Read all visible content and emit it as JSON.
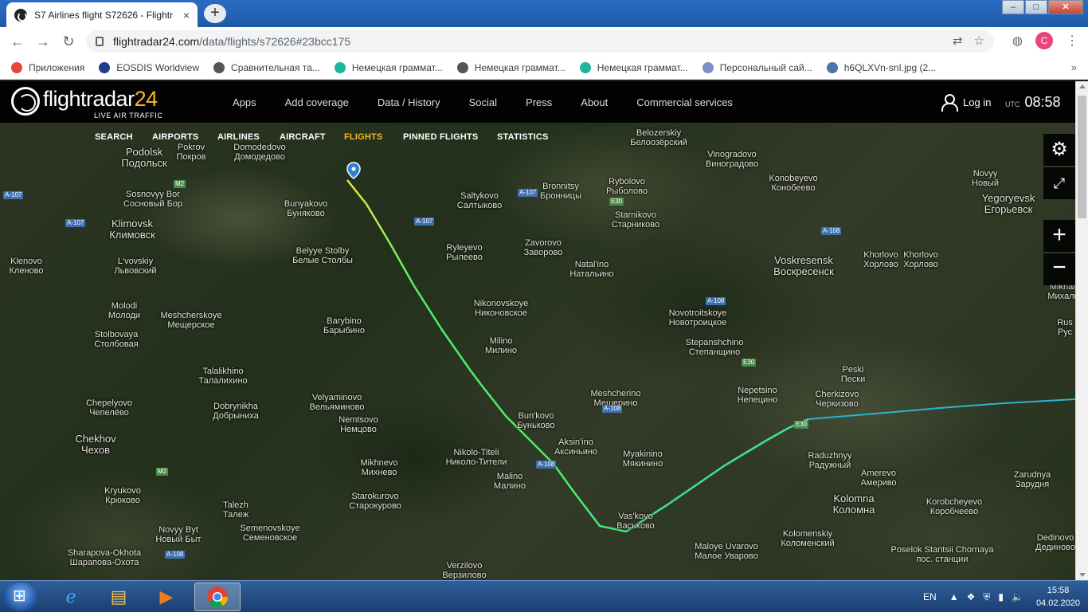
{
  "browser": {
    "tab_title": "S7 Airlines flight S72626 - Flightr",
    "tab_close": "×",
    "new_tab": "+",
    "url_host": "flightradar24.com",
    "url_path": "/data/flights/s72626#23bcc175",
    "window": {
      "minimize": "–",
      "maximize": "□",
      "close": "✕"
    },
    "avatar_letter": "C",
    "bookmarks": [
      {
        "label": "Приложения",
        "color": "#e8453c"
      },
      {
        "label": "EOSDIS Worldview",
        "color": "#1f3d8a"
      },
      {
        "label": "Сравнительная та...",
        "color": "#555555"
      },
      {
        "label": "Немецкая граммат...",
        "color": "#1fb59a"
      },
      {
        "label": "Немецкая граммат...",
        "color": "#555555"
      },
      {
        "label": "Немецкая граммат...",
        "color": "#1fb59a"
      },
      {
        "label": "Персональный сай...",
        "color": "#7a8fc9"
      },
      {
        "label": "h6QLXVn-snI.jpg (2...",
        "color": "#4a76a8"
      }
    ],
    "bookmarks_more": "»"
  },
  "fr24": {
    "logo_main": "flightradar",
    "logo_num": "24",
    "logo_sub": "LIVE AIR TRAFFIC",
    "nav": [
      "Apps",
      "Add coverage",
      "Data / History",
      "Social",
      "Press",
      "About",
      "Commercial services"
    ],
    "login": "Log in",
    "utc_label": "UTC",
    "time": "08:58",
    "subnav": [
      {
        "label": "SEARCH"
      },
      {
        "label": "AIRPORTS"
      },
      {
        "label": "AIRLINES"
      },
      {
        "label": "AIRCRAFT"
      },
      {
        "label": "FLIGHTS",
        "active": true
      },
      {
        "label": "PINNED FLIGHTS"
      },
      {
        "label": "STATISTICS"
      }
    ]
  },
  "map": {
    "places": [
      {
        "lat": "Podolsk",
        "cyr": "Подольск",
        "big": true
      },
      {
        "lat": "Sosnovyy Bor",
        "cyr": "Сосновый Бор"
      },
      {
        "lat": "Bunyakovo",
        "cyr": "Буняково"
      },
      {
        "lat": "Klimovsk",
        "cyr": "Климовск",
        "big": true
      },
      {
        "lat": "Klenovo",
        "cyr": "Кленово"
      },
      {
        "lat": "L'vovskiy",
        "cyr": "Львовский"
      },
      {
        "lat": "Belyye Stolby",
        "cyr": "Белые Столбы"
      },
      {
        "lat": "Molodi",
        "cyr": "Молоди"
      },
      {
        "lat": "Meshcherskoye",
        "cyr": "Мещерское"
      },
      {
        "lat": "Stolbovaya",
        "cyr": "Столбовая"
      },
      {
        "lat": "Barybino",
        "cyr": "Барыбино"
      },
      {
        "lat": "Talalikhino",
        "cyr": "Талалихино"
      },
      {
        "lat": "Chepelyovo",
        "cyr": "Чепелёво"
      },
      {
        "lat": "Dobrynikha",
        "cyr": "Добрыниха"
      },
      {
        "lat": "Velyaminovo",
        "cyr": "Вельяминово"
      },
      {
        "lat": "Nemtsovo",
        "cyr": "Немцово"
      },
      {
        "lat": "Chekhov",
        "cyr": "Чехов",
        "big": true
      },
      {
        "lat": "Mikhnevo",
        "cyr": "Михнево"
      },
      {
        "lat": "Kryukovo",
        "cyr": "Крюково"
      },
      {
        "lat": "Talezh",
        "cyr": "Талеж"
      },
      {
        "lat": "Starokurovo",
        "cyr": "Старокурово"
      },
      {
        "lat": "Semenovskoye",
        "cyr": "Семеновское"
      },
      {
        "lat": "Novyy Byt",
        "cyr": "Новый Быт"
      },
      {
        "lat": "Sharapova-Okhota",
        "cyr": "Шарапова-Охота"
      },
      {
        "lat": "Verzilovo",
        "cyr": "Верзилово"
      },
      {
        "lat": "Saltykovo",
        "cyr": "Салтыково"
      },
      {
        "lat": "Bronnitsy",
        "cyr": "Бронницы"
      },
      {
        "lat": "Rybolovo",
        "cyr": "Рыболово"
      },
      {
        "lat": "Ryleyevo",
        "cyr": "Рылеево"
      },
      {
        "lat": "Zavorovo",
        "cyr": "Заворово"
      },
      {
        "lat": "Starnikovo",
        "cyr": "Старниково"
      },
      {
        "lat": "Natal'ino",
        "cyr": "Натальино"
      },
      {
        "lat": "Nikonovskoye",
        "cyr": "Никоновское"
      },
      {
        "lat": "Milino",
        "cyr": "Милино"
      },
      {
        "lat": "Bun'kovo",
        "cyr": "Буньково"
      },
      {
        "lat": "Aksin'ino",
        "cyr": "Аксиньино"
      },
      {
        "lat": "Nikolo-Titeli",
        "cyr": "Николо-Тители"
      },
      {
        "lat": "Malino",
        "cyr": "Малино"
      },
      {
        "lat": "Meshcherino",
        "cyr": "Мещерино"
      },
      {
        "lat": "Myakinino",
        "cyr": "Мякинино"
      },
      {
        "lat": "Vas'kovo",
        "cyr": "Васьково"
      },
      {
        "lat": "Vinogradovo",
        "cyr": "Виноградово"
      },
      {
        "lat": "Konobeyevo",
        "cyr": "Конобеево"
      },
      {
        "lat": "Novyy",
        "cyr": "Новый"
      },
      {
        "lat": "Yegoryevsk",
        "cyr": "Егорьевск",
        "big": true
      },
      {
        "lat": "Voskresensk",
        "cyr": "Воскресенск",
        "big": true
      },
      {
        "lat": "Khorlovo",
        "cyr": "Хорлово"
      },
      {
        "lat": "Khorlovo",
        "cyr": "Хорлово"
      },
      {
        "lat": "Mikhali",
        "cyr": "Михали"
      },
      {
        "lat": "Novotroitskoye",
        "cyr": "Новотроицкое"
      },
      {
        "lat": "Stepanshchino",
        "cyr": "Степанщино"
      },
      {
        "lat": "Peski",
        "cyr": "Пески"
      },
      {
        "lat": "Nepetsino",
        "cyr": "Непецино"
      },
      {
        "lat": "Cherkizovo",
        "cyr": "Черкизово"
      },
      {
        "lat": "Raduzhnyy",
        "cyr": "Радужный"
      },
      {
        "lat": "Amerevo",
        "cyr": "Америво"
      },
      {
        "lat": "Zarudnya",
        "cyr": "Зарудня"
      },
      {
        "lat": "Kolomna",
        "cyr": "Коломна",
        "big": true
      },
      {
        "lat": "Korobcheyevo",
        "cyr": "Коробчеево"
      },
      {
        "lat": "Kolomenskiy",
        "cyr": "Коломенский"
      },
      {
        "lat": "Maloye Uvarovo",
        "cyr": "Малое Уварово"
      },
      {
        "lat": "Poselok Stantsii Chornaya",
        "cyr": "пос. станции"
      },
      {
        "lat": "Dedinovo",
        "cyr": "Дединово"
      },
      {
        "lat": "Rus",
        "cyr": "Рус"
      },
      {
        "lat": "Belozerskiy",
        "cyr": "Белоозёрский"
      },
      {
        "lat": "Pokrov",
        "cyr": "Покров"
      },
      {
        "lat": "Domodedovo",
        "cyr": "Домодедово"
      }
    ],
    "roads": [
      "A-107",
      "A-107",
      "A-107",
      "A-107",
      "A-108",
      "A-108",
      "A-108",
      "A-108",
      "A-108",
      "M2",
      "M2",
      "E30",
      "E30",
      "E30"
    ],
    "route_colors": {
      "start": "#e8e83a",
      "mid": "#48f06a",
      "end": "#2fd0c8",
      "tail": "#2ab5cf"
    }
  },
  "taskbar": {
    "lang": "EN",
    "time": "15:58",
    "date": "04.02.2020"
  }
}
